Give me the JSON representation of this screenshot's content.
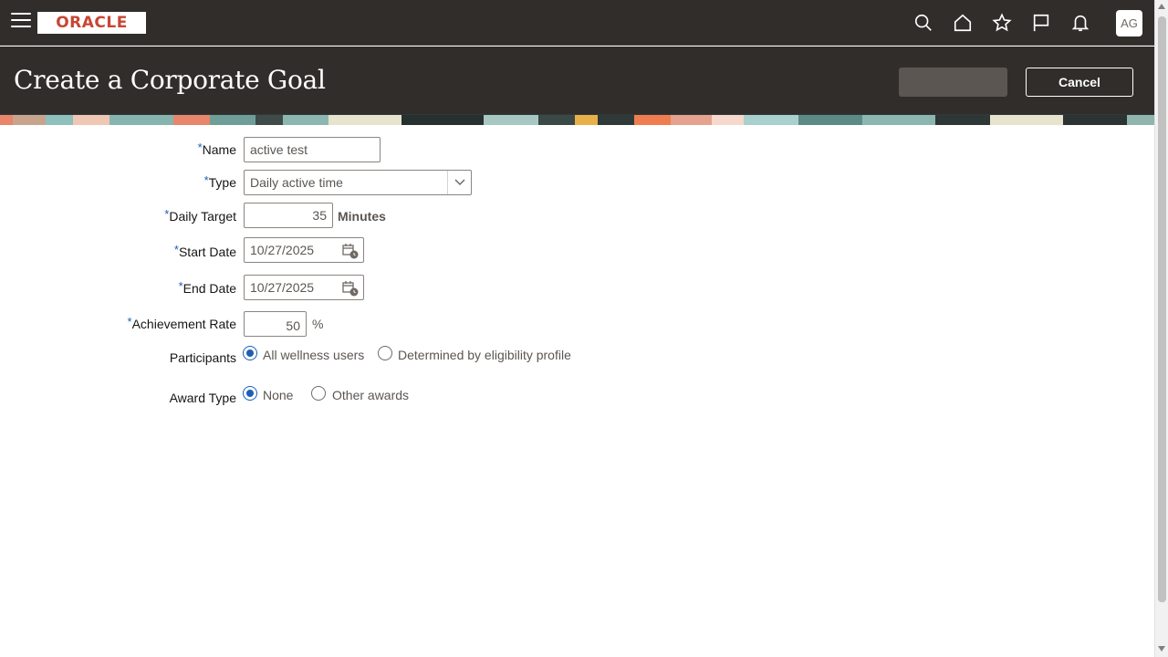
{
  "topbar": {
    "logo_text": "ORACLE",
    "avatar": "AG",
    "icons": [
      "search-icon",
      "home-icon",
      "star-icon",
      "flag-icon",
      "bell-icon"
    ]
  },
  "page": {
    "title": "Create a Corporate Goal",
    "cancel_label": "Cancel"
  },
  "form": {
    "name": {
      "label": "Name",
      "value": "active test"
    },
    "type": {
      "label": "Type",
      "value": "Daily active time"
    },
    "daily_target": {
      "label": "Daily Target",
      "value": "35",
      "unit": "Minutes"
    },
    "start_date": {
      "label": "Start Date",
      "value": "10/27/2025"
    },
    "end_date": {
      "label": "End Date",
      "value": "10/27/2025"
    },
    "achievement_rate": {
      "label": "Achievement Rate",
      "value": "50",
      "unit": "%"
    },
    "participants": {
      "label": "Participants",
      "options": [
        "All wellness users",
        "Determined by eligibility profile"
      ],
      "selected": "All wellness users"
    },
    "award_type": {
      "label": "Award Type",
      "options": [
        "None",
        "Other awards"
      ],
      "selected": "None"
    },
    "required_marker": "*"
  },
  "colors": {
    "header_bg": "#312d2a",
    "brand_red": "#c74634",
    "required_blue": "#1b5fb5",
    "radio_selected": "#1b5fb5"
  }
}
